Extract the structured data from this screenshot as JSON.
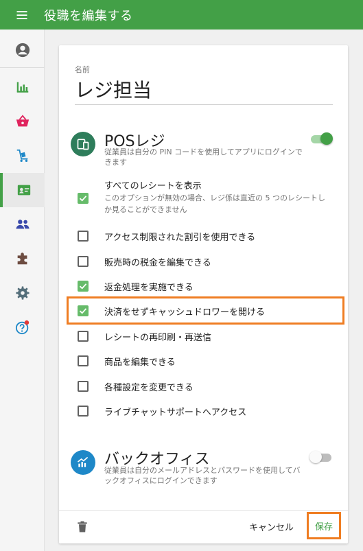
{
  "header": {
    "title": "役職を編集する"
  },
  "form": {
    "name_label": "名前",
    "name_value": "レジ担当"
  },
  "pos": {
    "title": "POSレジ",
    "desc": "従業員は自分の PIN コードを使用してアプリにログインできます",
    "enabled": true
  },
  "permissions": [
    {
      "label": "すべてのレシートを表示",
      "desc": "このオプションが無効の場合、レジ係は直近の 5 つのレシートしか見ることができません",
      "checked": true
    },
    {
      "label": "アクセス制限された割引を使用できる",
      "checked": false
    },
    {
      "label": "販売時の税金を編集できる",
      "checked": false
    },
    {
      "label": "返金処理を実施できる",
      "checked": true
    },
    {
      "label": "決済をせずキャッシュドロワーを開ける",
      "checked": true
    },
    {
      "label": "レシートの再印刷・再送信",
      "checked": false
    },
    {
      "label": "商品を編集できる",
      "checked": false
    },
    {
      "label": "各種設定を変更できる",
      "checked": false
    },
    {
      "label": "ライブチャットサポートへアクセス",
      "checked": false
    }
  ],
  "backoffice": {
    "title": "バックオフィス",
    "desc": "従業員は自分のメールアドレスとパスワードを使用してバックオフィスにログインできます",
    "enabled": false
  },
  "footer": {
    "cancel_label": "キャンセル",
    "save_label": "保存"
  },
  "colors": {
    "brand": "#43a047",
    "highlight": "#ef7d22",
    "pos_icon": "#2e7d5b",
    "backoffice_icon": "#1e88c8"
  },
  "sidebar": {
    "items": [
      {
        "icon": "account-circle-icon",
        "color": "#616161"
      },
      {
        "icon": "bar-chart-icon",
        "color": "#43a047"
      },
      {
        "icon": "basket-icon",
        "color": "#e0245e"
      },
      {
        "icon": "inventory-cart-icon",
        "color": "#1e88c8"
      },
      {
        "icon": "employee-badge-icon",
        "color": "#43a047"
      },
      {
        "icon": "customers-icon",
        "color": "#3949ab"
      },
      {
        "icon": "integrations-puzzle-icon",
        "color": "#6d4c41"
      },
      {
        "icon": "settings-gear-icon",
        "color": "#546e7a"
      },
      {
        "icon": "help-icon",
        "color": "#1e88c8"
      }
    ]
  }
}
